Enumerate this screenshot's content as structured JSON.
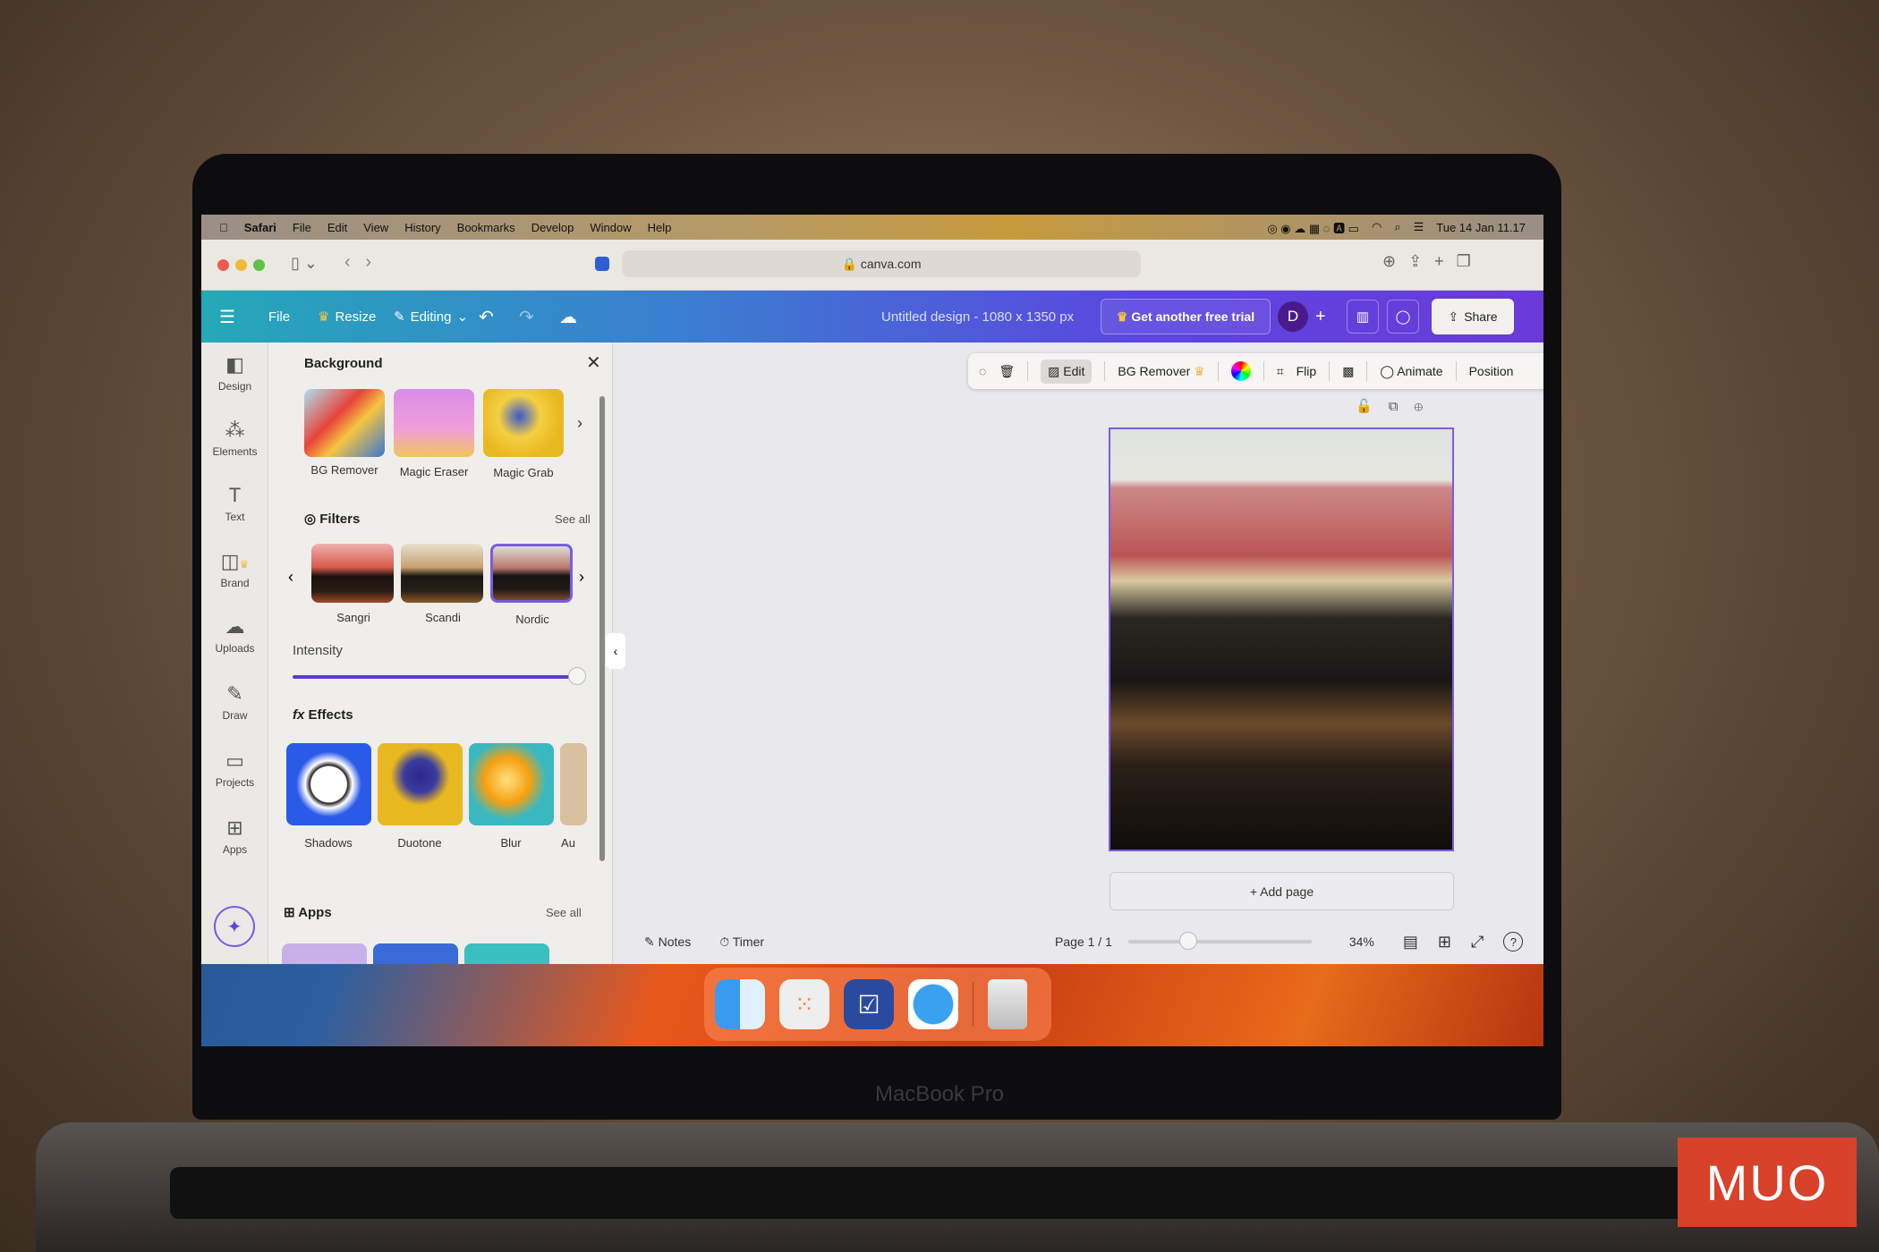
{
  "laptop_label": "MacBook Pro",
  "watermark": "MUO",
  "menubar": {
    "items": [
      "Safari",
      "File",
      "Edit",
      "View",
      "History",
      "Bookmarks",
      "Develop",
      "Window",
      "Help"
    ],
    "clock": "Tue 14 Jan 11.17"
  },
  "safari": {
    "url": "canva.com"
  },
  "canva_header": {
    "file": "File",
    "resize": "Resize",
    "editing": "Editing",
    "design_title": "Untitled design - 1080 x 1350 px",
    "trial": "Get another free trial",
    "avatar": "D",
    "share": "Share",
    "accent_start": "#25a8b8",
    "accent_end": "#6a3ad8"
  },
  "rail": [
    {
      "label": "Design",
      "icon": "layout-icon"
    },
    {
      "label": "Elements",
      "icon": "shapes-icon"
    },
    {
      "label": "Text",
      "icon": "text-icon"
    },
    {
      "label": "Brand",
      "icon": "brand-icon"
    },
    {
      "label": "Uploads",
      "icon": "cloud-upload-icon"
    },
    {
      "label": "Draw",
      "icon": "pen-icon"
    },
    {
      "label": "Projects",
      "icon": "folder-icon"
    },
    {
      "label": "Apps",
      "icon": "apps-icon"
    }
  ],
  "panel": {
    "title": "Background",
    "tools": [
      "BG Remover",
      "Magic Eraser",
      "Magic Grab"
    ],
    "filters_title": "Filters",
    "see_all": "See all",
    "filters": [
      "Sangri",
      "Scandi",
      "Nordic"
    ],
    "selected_filter": "Nordic",
    "intensity_label": "Intensity",
    "intensity_value": 100,
    "effects_title": "Effects",
    "effects": [
      "Shadows",
      "Duotone",
      "Blur",
      "Au"
    ],
    "apps_title": "Apps",
    "apps_see_all": "See all"
  },
  "toolbar": {
    "edit": "Edit",
    "bg_remover": "BG Remover",
    "flip": "Flip",
    "animate": "Animate",
    "position": "Position"
  },
  "canvas": {
    "add_page": "+ Add page",
    "notes": "Notes",
    "timer": "Timer",
    "page_indicator": "Page 1 / 1",
    "zoom": "34%",
    "zoom_value": 34
  }
}
